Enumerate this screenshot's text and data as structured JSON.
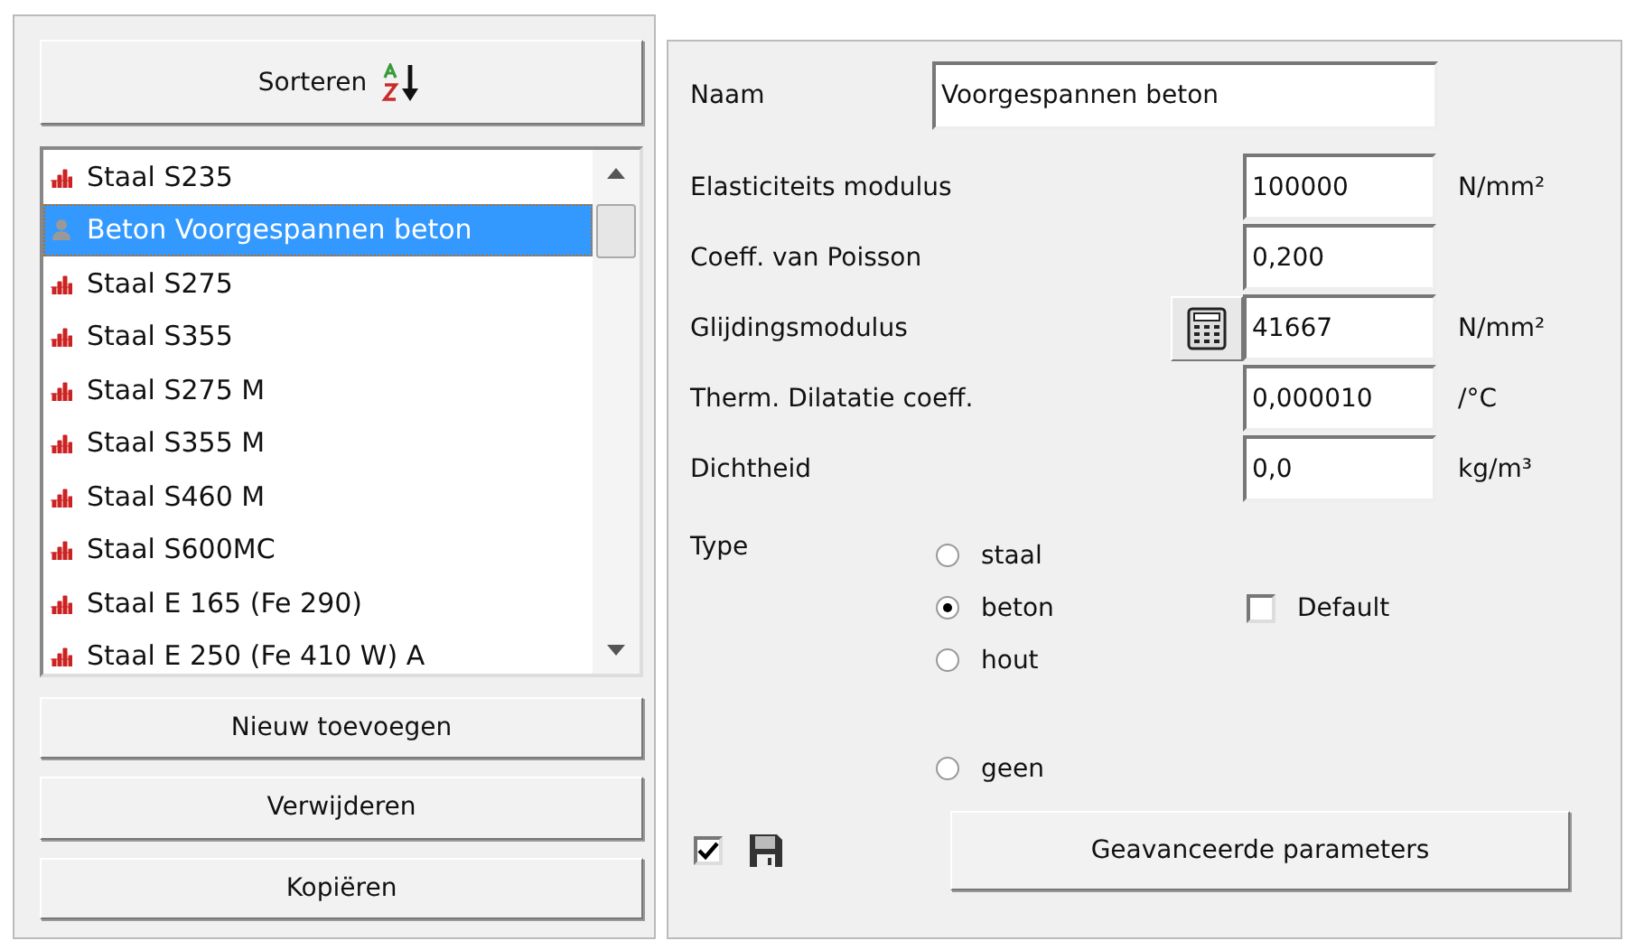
{
  "sort_button": {
    "label": "Sorteren"
  },
  "materials": [
    {
      "label": "Staal S235",
      "kind": "steel",
      "selected": false
    },
    {
      "label": "Beton Voorgespannen beton",
      "kind": "concrete",
      "selected": true
    },
    {
      "label": "Staal S275",
      "kind": "steel",
      "selected": false
    },
    {
      "label": "Staal S355",
      "kind": "steel",
      "selected": false
    },
    {
      "label": "Staal S275 M",
      "kind": "steel",
      "selected": false
    },
    {
      "label": "Staal S355 M",
      "kind": "steel",
      "selected": false
    },
    {
      "label": "Staal S460 M",
      "kind": "steel",
      "selected": false
    },
    {
      "label": "Staal S600MC",
      "kind": "steel",
      "selected": false
    },
    {
      "label": "Staal E 165 (Fe 290)",
      "kind": "steel",
      "selected": false
    },
    {
      "label": "Staal E 250 (Fe 410 W) A",
      "kind": "steel",
      "selected": false
    }
  ],
  "list_buttons": [
    "Nieuw toevoegen",
    "Verwijderen",
    "Kopiëren"
  ],
  "name_field": {
    "label": "Naam",
    "value": "Voorgespannen beton"
  },
  "properties": [
    {
      "label": "Elasticiteits modulus",
      "value": "100000",
      "unit": "N/mm²",
      "calculator": false
    },
    {
      "label": "Coeff. van Poisson",
      "value": "0,200",
      "calculator": false
    },
    {
      "label": "Glijdingsmodulus",
      "value": "41667",
      "unit": "N/mm²",
      "calculator": true
    },
    {
      "label": "Therm. Dilatatie coeff.",
      "value": "0,000010",
      "unit": "/°C",
      "calculator": false
    },
    {
      "label": "Dichtheid",
      "value": "0,0",
      "unit": "kg/m³",
      "calculator": false
    }
  ],
  "type": {
    "label": "Type",
    "options": [
      {
        "label": "staal",
        "selected": false
      },
      {
        "label": "beton",
        "selected": true
      },
      {
        "label": "hout",
        "selected": false
      },
      {
        "label": "geen",
        "selected": false
      }
    ]
  },
  "default_checkbox": {
    "label": "Default",
    "checked": false
  },
  "save_checkbox": {
    "checked": true
  },
  "advanced_button": {
    "label": "Geavanceerde parameters"
  }
}
